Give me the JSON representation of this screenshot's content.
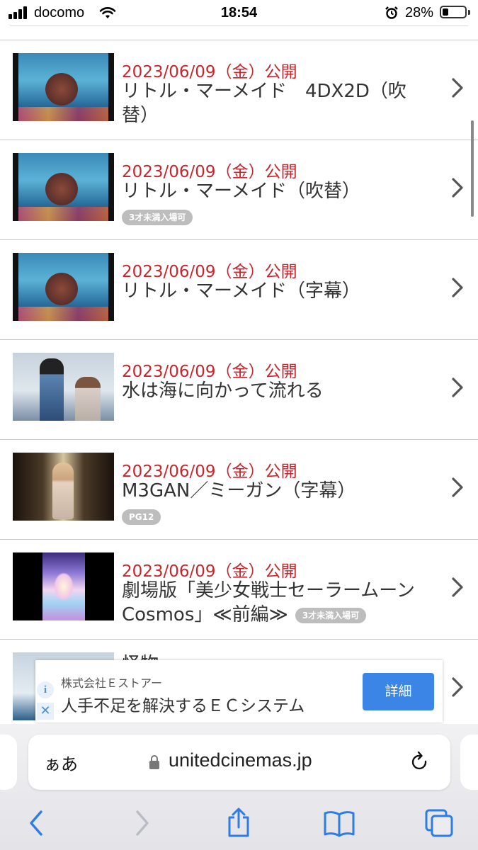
{
  "status_bar": {
    "carrier": "docomo",
    "time": "18:54",
    "battery": "28%",
    "battery_level": 0.28
  },
  "movies": [
    {
      "date": "2023/06/09（金）公開",
      "title": "リトル・マーメイド　4DX2D（吹替）",
      "badge": "",
      "thumb": "sea"
    },
    {
      "date": "2023/06/09（金）公開",
      "title": "リトル・マーメイド（吹替）",
      "badge": "3才未満入場可",
      "thumb": "sea"
    },
    {
      "date": "2023/06/09（金）公開",
      "title": "リトル・マーメイド（字幕）",
      "badge": "",
      "thumb": "sea"
    },
    {
      "date": "2023/06/09（金）公開",
      "title": "水は海に向かって流れる",
      "badge": "",
      "thumb": "snow"
    },
    {
      "date": "2023/06/09（金）公開",
      "title": "M3GAN／ミーガン（字幕）",
      "badge": "PG12",
      "thumb": "dark"
    },
    {
      "date": "2023/06/09（金）公開",
      "title": "劇場版「美少女戦士セーラームーンCosmos」≪前編≫",
      "badge": "3才未満入場可",
      "thumb": "anime"
    },
    {
      "date": "",
      "title": "怪物",
      "badge": "",
      "thumb": "snow2"
    }
  ],
  "ad": {
    "company": "株式会社Ｅストアー",
    "headline": "人手不足を解決するＥＣシステム",
    "button": "詳細",
    "info_icon": "i",
    "close_icon": "✕"
  },
  "browser": {
    "text_size_label": "ぁあ",
    "url": "unitedcinemas.jp"
  },
  "colors": {
    "date_red": "#c8262c",
    "ad_button_blue": "#3a85e6",
    "ios_blue": "#2f7de1"
  }
}
